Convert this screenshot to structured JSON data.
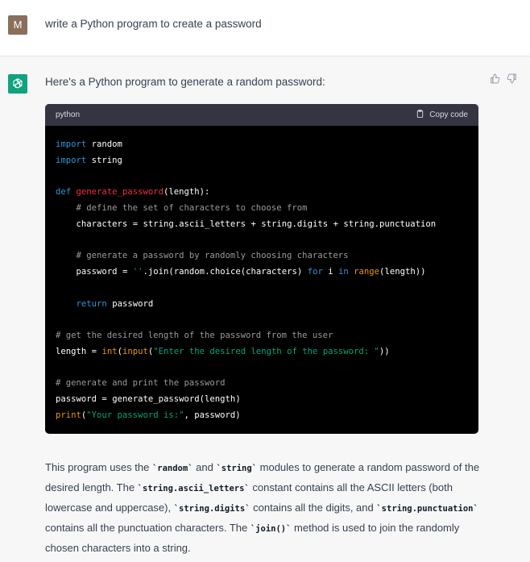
{
  "user": {
    "avatar_letter": "M",
    "avatar_color": "#8a6f5c",
    "message": "write a Python program to create a password"
  },
  "assistant": {
    "avatar_icon": "openai-logo-icon",
    "avatar_color": "#10a37f",
    "feedback_icons": [
      "thumbs-up-icon",
      "thumbs-down-icon"
    ],
    "intro": "Here's a Python program to generate a random password:",
    "code_block": {
      "language": "python",
      "copy_label": "Copy code",
      "copy_icon": "clipboard-icon",
      "lines": [
        "import random",
        "import string",
        "",
        "def generate_password(length):",
        "    # define the set of characters to choose from",
        "    characters = string.ascii_letters + string.digits + string.punctuation",
        "",
        "    # generate a password by randomly choosing characters",
        "    password = ''.join(random.choice(characters) for i in range(length))",
        "",
        "    return password",
        "",
        "# get the desired length of the password from the user",
        "length = int(input(\"Enter the desired length of the password: \"))",
        "",
        "# generate and print the password",
        "password = generate_password(length)",
        "print(\"Your password is:\", password)"
      ],
      "colors": {
        "keyword": "#2e95d3",
        "function_name": "#f22c3d",
        "builtin": "#e9950c",
        "comment": "#9a9a9a",
        "string": "#00a67d",
        "default": "#ffffff"
      }
    },
    "explanation": {
      "p1": "This program uses the ",
      "c1": "`random`",
      "p2": " and ",
      "c2": "`string`",
      "p3": " modules to generate a random password of the desired length. The ",
      "c3": "`string.ascii_letters`",
      "p4": " constant contains all the ASCII letters (both lowercase and uppercase), ",
      "c4": "`string.digits`",
      "p5": " contains all the digits, and ",
      "c5": "`string.punctuation`",
      "p6": " contains all the punctuation characters. The ",
      "c6": "`join()`",
      "p7": " method is used to join the randomly chosen characters into a string."
    }
  }
}
